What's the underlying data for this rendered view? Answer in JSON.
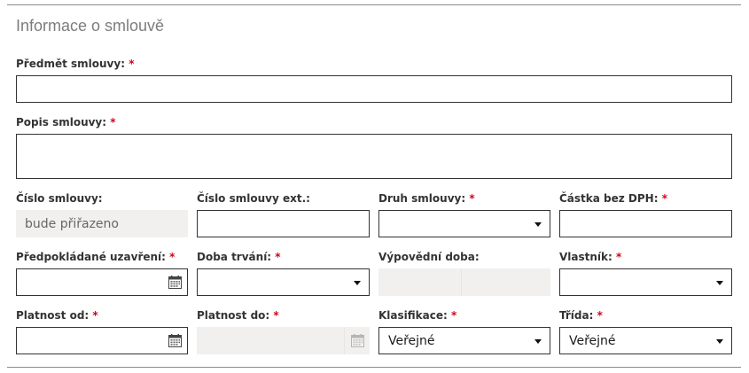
{
  "section": {
    "title": "Informace o smlouvě"
  },
  "required_marker": "*",
  "fields": {
    "predmet": {
      "label": "Předmět smlouvy:",
      "value": ""
    },
    "popis": {
      "label": "Popis smlouvy:",
      "value": ""
    },
    "cislo": {
      "label": "Číslo smlouvy:",
      "value": "bude přiřazeno"
    },
    "cislo_ext": {
      "label": "Číslo smlouvy ext.:",
      "value": ""
    },
    "druh": {
      "label": "Druh smlouvy:",
      "value": ""
    },
    "castka": {
      "label": "Částka bez DPH:",
      "value": ""
    },
    "uzavreni": {
      "label": "Předpokládané uzavření:",
      "value": ""
    },
    "doba": {
      "label": "Doba trvání:",
      "value": ""
    },
    "vypovedni": {
      "label": "Výpovědní doba:",
      "value": ""
    },
    "vlastnik": {
      "label": "Vlastník:",
      "value": ""
    },
    "platnost_od": {
      "label": "Platnost od:",
      "value": ""
    },
    "platnost_do": {
      "label": "Platnost do:",
      "value": ""
    },
    "klasifikace": {
      "label": "Klasifikace:",
      "value": "Veřejné"
    },
    "trida": {
      "label": "Třída:",
      "value": "Veřejné"
    }
  },
  "icons": {
    "calendar": "calendar-icon",
    "dropdown": "chevron-down-icon"
  },
  "colors": {
    "required": "#d0021b",
    "disabled_bg": "#f1f0ef",
    "border": "#333333",
    "title": "#7d7d7d"
  }
}
